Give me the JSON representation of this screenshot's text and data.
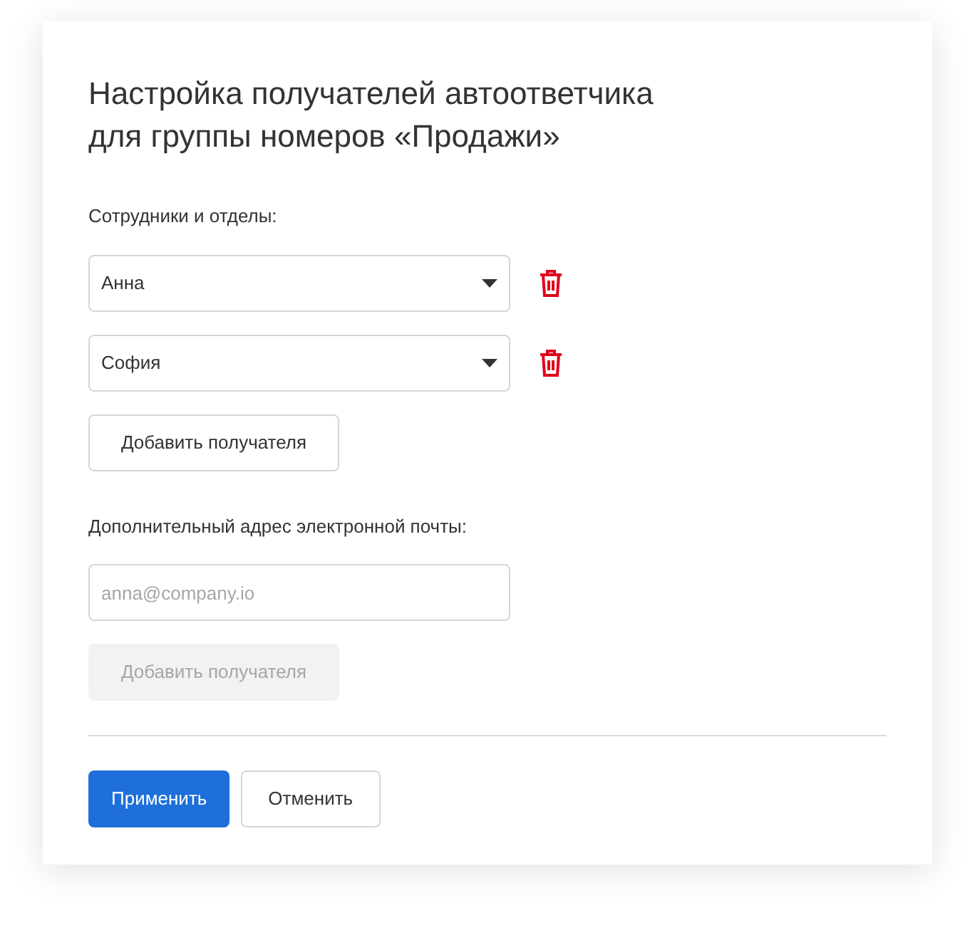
{
  "title": "Настройка получателей автоответчика\nдля группы номеров «Продажи»",
  "staff": {
    "label": "Сотрудники и отделы:",
    "recipients": [
      {
        "value": "Анна"
      },
      {
        "value": "София"
      }
    ],
    "add_button": {
      "label": "Добавить получателя",
      "disabled": false
    }
  },
  "email": {
    "label": "Дополнительный адрес электронной почты:",
    "placeholder": "anna@company.io",
    "add_button": {
      "label": "Добавить получателя",
      "disabled": true
    }
  },
  "actions": [
    {
      "label": "Применить",
      "kind": "primary"
    },
    {
      "label": "Отменить",
      "kind": "secondary"
    }
  ]
}
